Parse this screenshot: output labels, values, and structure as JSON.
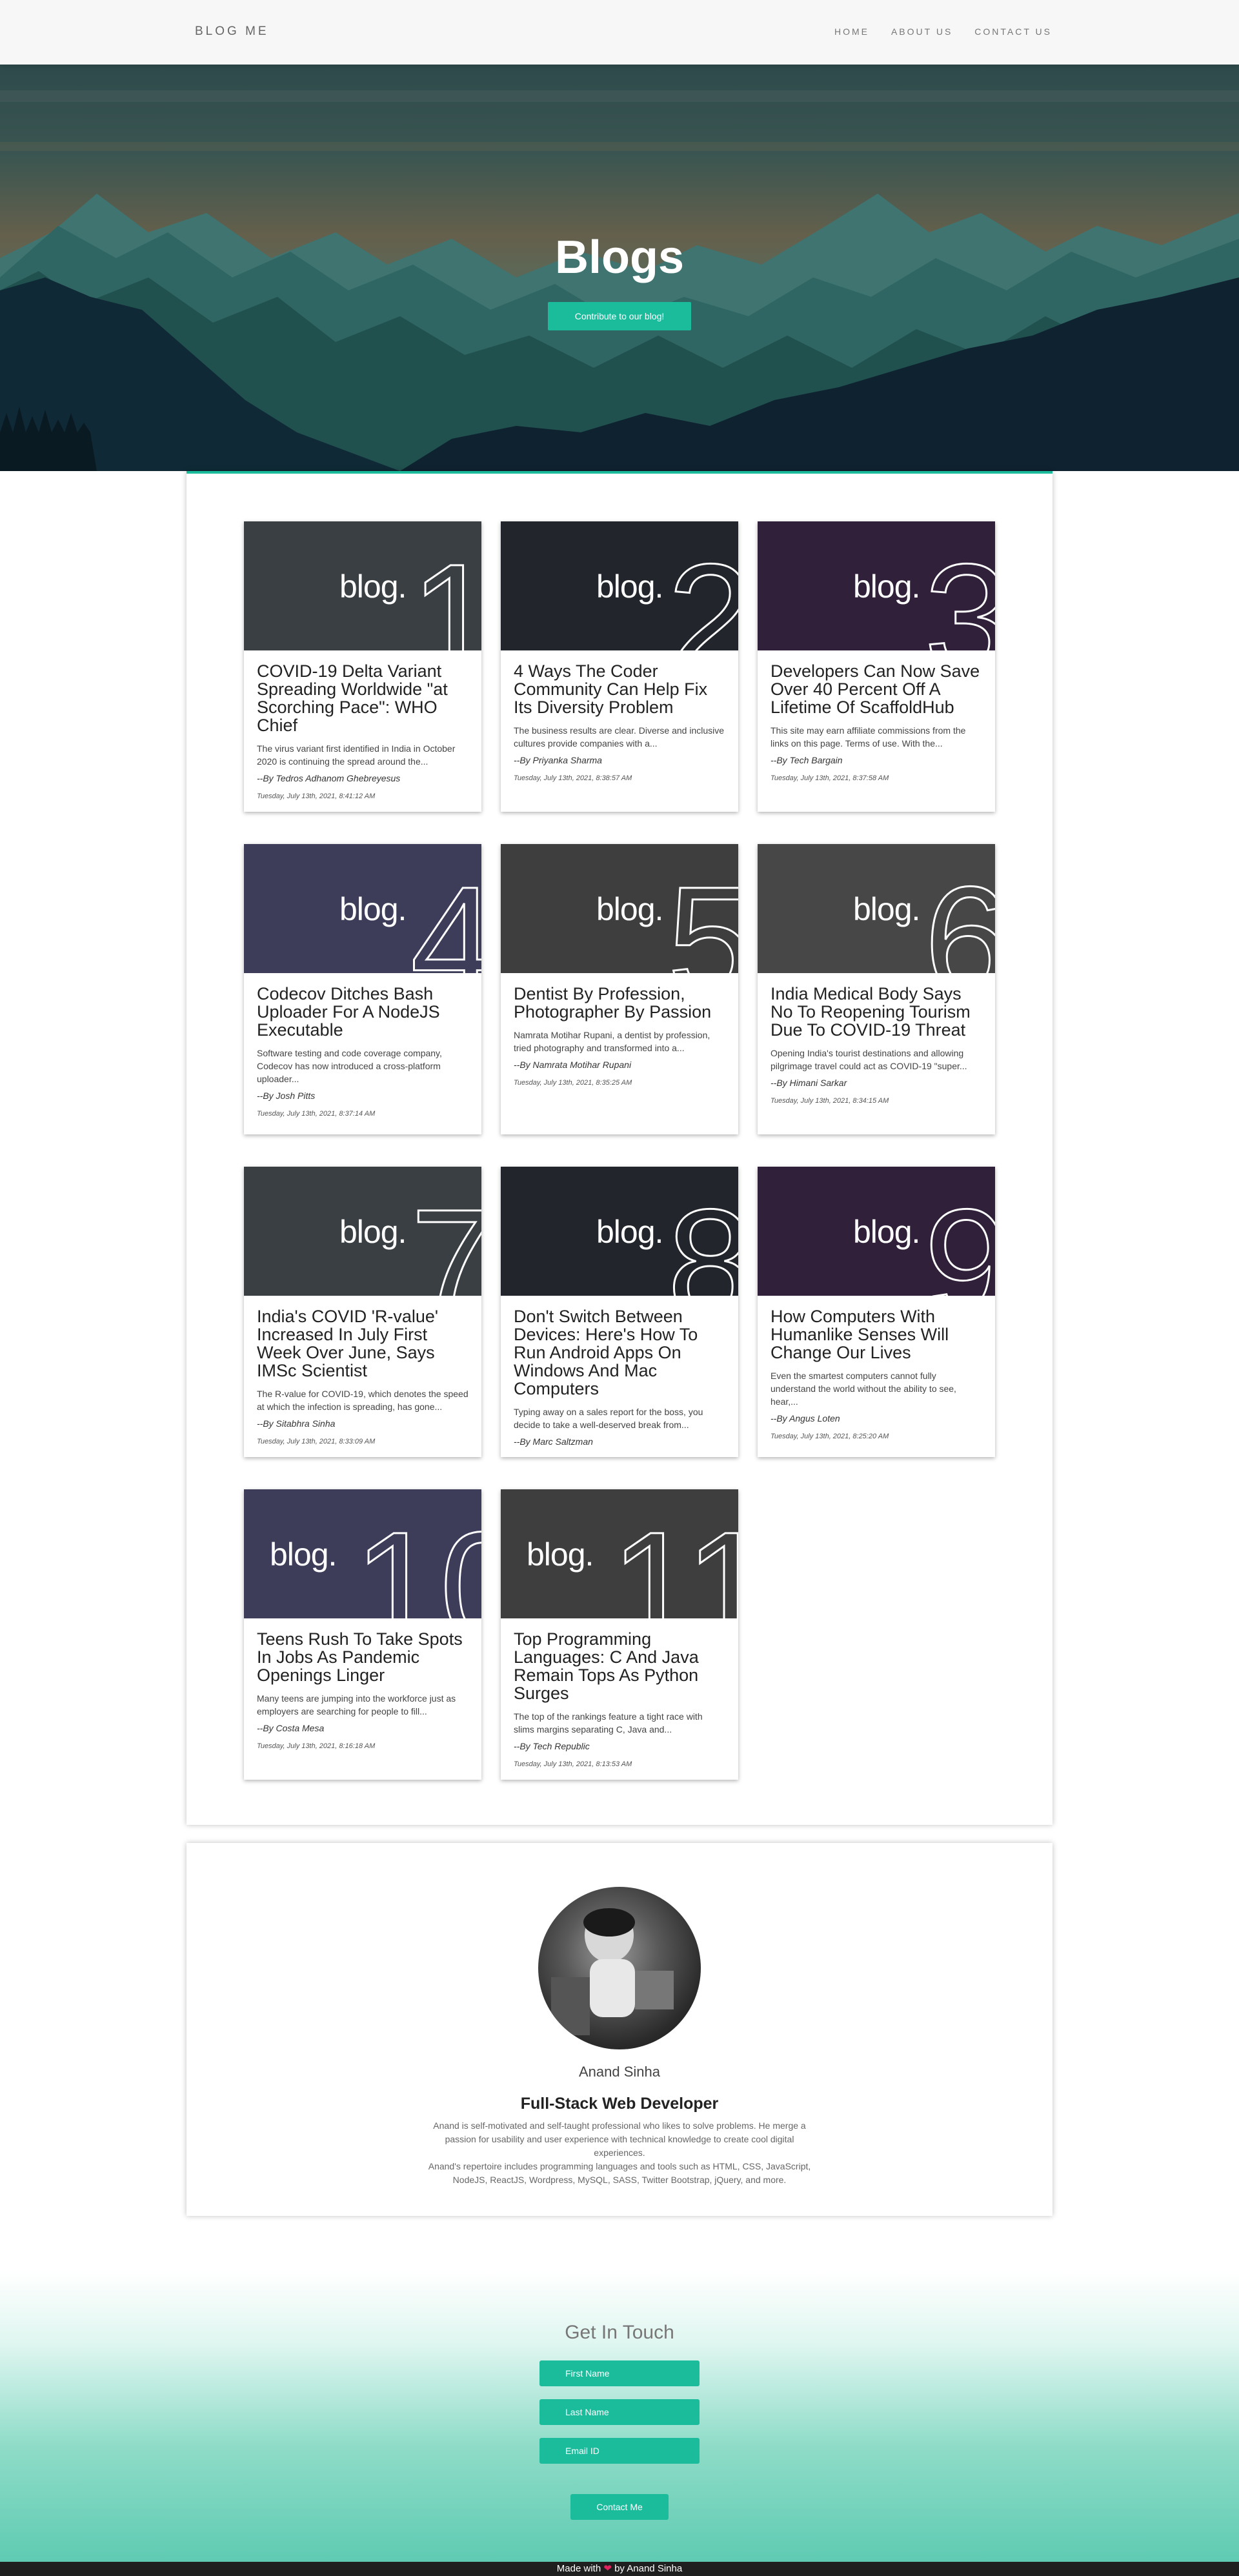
{
  "nav": {
    "brand": "BLOG ME",
    "links": [
      "HOME",
      "ABOUT US",
      "CONTACT US"
    ]
  },
  "hero": {
    "title": "Blogs",
    "button": "Contribute to our blog!"
  },
  "blogs": [
    {
      "thumb_word": "blog.",
      "number": "1",
      "bg": "#3a3f44",
      "title": "COVID-19 Delta Variant Spreading Worldwide \"at Scorching Pace\": WHO Chief",
      "desc": "The virus variant first identified in India in October 2020 is continuing the spread around the...",
      "author": "--By Tedros Adhanom Ghebreyesus",
      "date": "Tuesday, July 13th, 2021, 8:41:12 AM"
    },
    {
      "thumb_word": "blog.",
      "number": "2",
      "bg": "#22262c",
      "title": "4 Ways The Coder Community Can Help Fix Its Diversity Problem",
      "desc": "The business results are clear. Diverse and inclusive cultures provide companies with a...",
      "author": "--By Priyanka Sharma",
      "date": "Tuesday, July 13th, 2021, 8:38:57 AM"
    },
    {
      "thumb_word": "blog.",
      "number": "3",
      "bg": "#31203a",
      "title": "Developers Can Now Save Over 40 Percent Off A Lifetime Of ScaffoldHub",
      "desc": "This site may earn affiliate commissions from the links on this page. Terms of use. With the...",
      "author": "--By Tech Bargain",
      "date": "Tuesday, July 13th, 2021, 8:37:58 AM"
    },
    {
      "thumb_word": "blog.",
      "number": "4",
      "bg": "#3d3d5a",
      "title": "Codecov Ditches Bash Uploader For A NodeJS Executable",
      "desc": "Software testing and code coverage company, Codecov has now introduced a cross-platform uploader...",
      "author": "--By Josh Pitts",
      "date": "Tuesday, July 13th, 2021, 8:37:14 AM"
    },
    {
      "thumb_word": "blog.",
      "number": "5",
      "bg": "#3e3e3e",
      "title": "Dentist By Profession, Photographer By Passion",
      "desc": "Namrata Motihar Rupani, a dentist by profession, tried photography and transformed into a...",
      "author": "--By Namrata Motihar Rupani",
      "date": "Tuesday, July 13th, 2021, 8:35:25 AM"
    },
    {
      "thumb_word": "blog.",
      "number": "6",
      "bg": "#474747",
      "title": "India Medical Body Says No To Reopening Tourism Due To COVID-19 Threat",
      "desc": "Opening India's tourist destinations and allowing pilgrimage travel could act as COVID-19 \"super...",
      "author": "--By Himani Sarkar",
      "date": "Tuesday, July 13th, 2021, 8:34:15 AM"
    },
    {
      "thumb_word": "blog.",
      "number": "7",
      "bg": "#3a3f44",
      "title": "India's COVID 'R-value' Increased In July First Week Over June, Says IMSc Scientist",
      "desc": "The R-value for COVID-19, which denotes the speed at which the infection is spreading, has gone...",
      "author": "--By Sitabhra Sinha",
      "date": "Tuesday, July 13th, 2021, 8:33:09 AM"
    },
    {
      "thumb_word": "blog.",
      "number": "8",
      "bg": "#22262c",
      "title": "Don't Switch Between Devices: Here's How To Run Android Apps On Windows And Mac Computers",
      "desc": "Typing away on a sales report for the boss, you decide to take a well-deserved break from...",
      "author": "--By Marc Saltzman",
      "date": ""
    },
    {
      "thumb_word": "blog.",
      "number": "9",
      "bg": "#31203a",
      "title": "How Computers With Humanlike Senses Will Change Our Lives",
      "desc": "Even the smartest computers cannot fully understand the world without the ability to see, hear,...",
      "author": "--By Angus Loten",
      "date": "Tuesday, July 13th, 2021, 8:25:20 AM"
    },
    {
      "thumb_word": "blog.",
      "number": "10",
      "bg": "#3d3d5a",
      "title": "Teens Rush To Take Spots In Jobs As Pandemic Openings Linger",
      "desc": "Many teens are jumping into the workforce just as employers are searching for people to fill...",
      "author": "--By Costa Mesa",
      "date": "Tuesday, July 13th, 2021, 8:16:18 AM"
    },
    {
      "thumb_word": "blog.",
      "number": "11",
      "bg": "#3e3e3e",
      "title": "Top Programming Languages: C And Java Remain Tops As Python Surges",
      "desc": "The top of the rankings feature a tight race with slims margins separating C, Java and...",
      "author": "--By Tech Republic",
      "date": "Tuesday, July 13th, 2021, 8:13:53 AM"
    }
  ],
  "about": {
    "name": "Anand Sinha",
    "role": "Full-Stack Web Developer",
    "text1": "Anand is self-motivated and self-taught professional who likes to solve problems. He merge a passion for usability and user experience with technical knowledge to create cool digital experiences.",
    "text2": "Anand's repertoire includes programming languages and tools such as HTML, CSS, JavaScript, NodeJS, ReactJS, Wordpress, MySQL, SASS, Twitter Bootstrap, jQuery, and more."
  },
  "contact": {
    "title": "Get In Touch",
    "first_name": "First Name",
    "last_name": "Last Name",
    "email": "Email ID",
    "button": "Contact Me"
  },
  "footer": {
    "made_with": "Made with",
    "heart": "❤",
    "by": "by Anand Sinha"
  },
  "colors": {
    "accent": "#1abc9c",
    "footer_bg": "#1f1f1f"
  }
}
